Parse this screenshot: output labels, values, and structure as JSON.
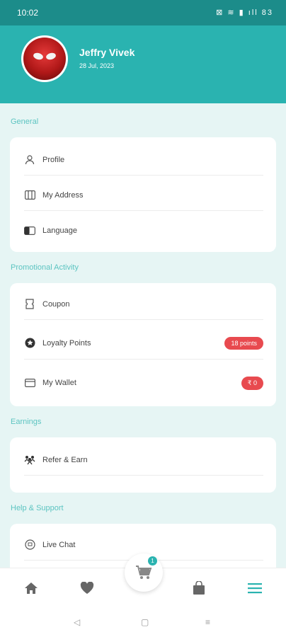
{
  "status": {
    "time": "10:02",
    "icons": "⊠ ≋ ▮ ıll 83"
  },
  "profile": {
    "name": "Jeffry Vivek",
    "date": "28 Jul, 2023"
  },
  "sections": {
    "general": {
      "title": "General",
      "items": [
        "Profile",
        "My Address",
        "Language"
      ]
    },
    "promo": {
      "title": "Promotional Activity",
      "items": [
        "Coupon",
        "Loyalty Points",
        "My Wallet"
      ],
      "loyalty_badge": "18 points",
      "wallet_badge": "₹ 0"
    },
    "earnings": {
      "title": "Earnings",
      "items": [
        "Refer & Earn"
      ]
    },
    "help": {
      "title": "Help & Support",
      "items": [
        "Live Chat"
      ]
    }
  },
  "cart": {
    "count": "1"
  },
  "colors": {
    "primary": "#2ab3b0",
    "statusbar": "#1c8c8a",
    "badge": "#e84a4f"
  }
}
